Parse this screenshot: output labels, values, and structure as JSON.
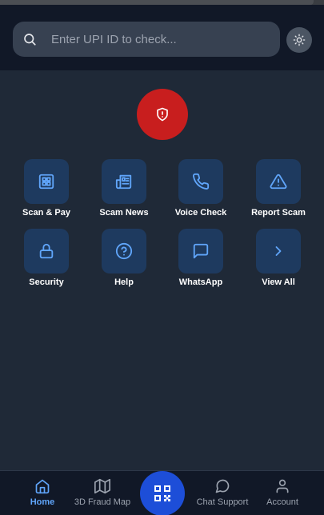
{
  "search": {
    "placeholder": "Enter UPI ID to check..."
  },
  "actions": [
    {
      "label": "Scan & Pay",
      "icon": "scan-grid-icon"
    },
    {
      "label": "Scam News",
      "icon": "newspaper-icon"
    },
    {
      "label": "Voice Check",
      "icon": "phone-icon"
    },
    {
      "label": "Report Scam",
      "icon": "warning-triangle-icon"
    },
    {
      "label": "Security",
      "icon": "lock-icon"
    },
    {
      "label": "Help",
      "icon": "help-circle-icon"
    },
    {
      "label": "WhatsApp",
      "icon": "message-square-icon"
    },
    {
      "label": "View All",
      "icon": "chevron-right-icon"
    }
  ],
  "nav": {
    "home": "Home",
    "map": "3D Fraud Map",
    "chat": "Chat Support",
    "account": "Account"
  },
  "colors": {
    "background": "#1f2937",
    "header": "#111827",
    "accent": "#60a5fa",
    "danger": "#c81e1e",
    "tile": "#1e3a5f",
    "fab": "#1d4ed8"
  }
}
